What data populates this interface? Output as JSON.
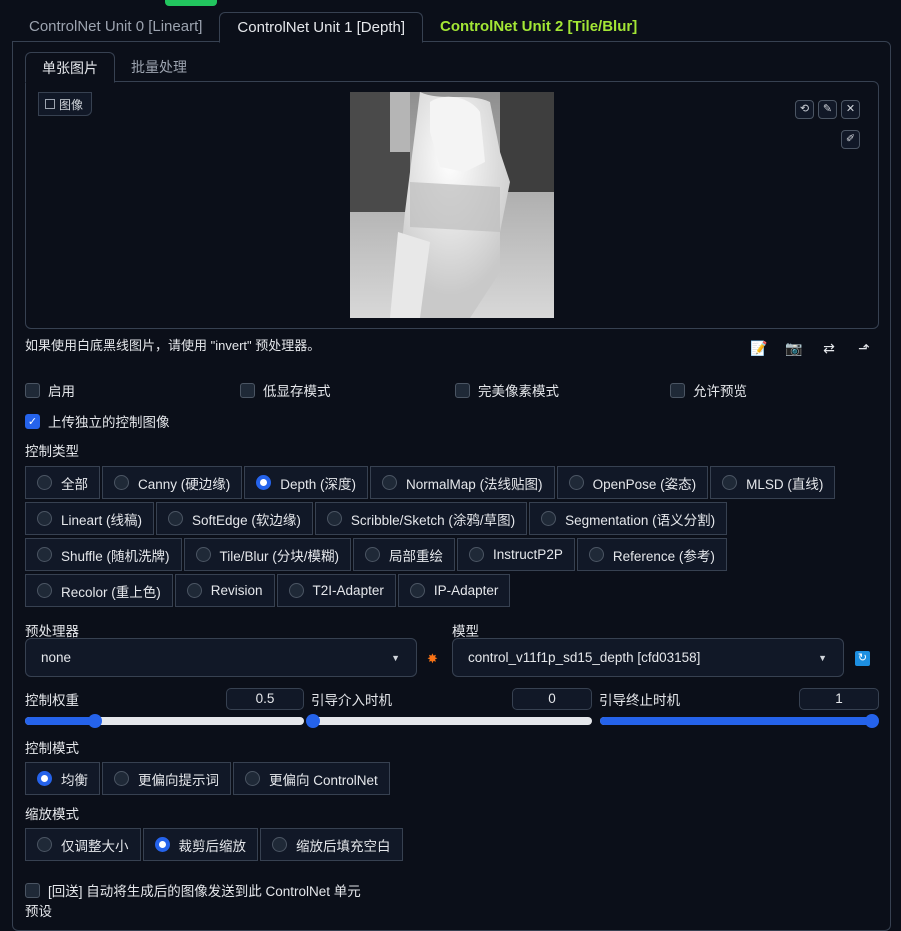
{
  "outer_tabs": [
    "ControlNet Unit 0 [Lineart]",
    "ControlNet Unit 1 [Depth]",
    "ControlNet Unit 2 [Tile/Blur]"
  ],
  "inner_tabs": [
    "单张图片",
    "批量处理"
  ],
  "image_label": "图像",
  "image_tools": {
    "reset": "⟲",
    "brush": "✎",
    "close": "✕",
    "pen": "✐"
  },
  "hint": "如果使用白底黑线图片，请使用 \"invert\" 预处理器。",
  "action_icons": [
    "📝",
    "📷",
    "⇄",
    "⬏"
  ],
  "checkboxes": [
    {
      "label": "启用",
      "checked": false
    },
    {
      "label": "低显存模式",
      "checked": false
    },
    {
      "label": "完美像素模式",
      "checked": false
    },
    {
      "label": "允许预览",
      "checked": false
    },
    {
      "label": "上传独立的控制图像",
      "checked": true
    }
  ],
  "control_type_label": "控制类型",
  "control_types": [
    [
      "全部",
      "Canny (硬边缘)",
      "Depth (深度)",
      "NormalMap (法线贴图)",
      "OpenPose (姿态)",
      "MLSD (直线)"
    ],
    [
      "Lineart (线稿)",
      "SoftEdge (软边缘)",
      "Scribble/Sketch (涂鸦/草图)",
      "Segmentation (语义分割)"
    ],
    [
      "Shuffle (随机洗牌)",
      "Tile/Blur (分块/模糊)",
      "局部重绘",
      "InstructP2P",
      "Reference (参考)"
    ],
    [
      "Recolor (重上色)",
      "Revision",
      "T2I-Adapter",
      "IP-Adapter"
    ]
  ],
  "control_type_selected": "Depth (深度)",
  "preprocessor_label": "预处理器",
  "preprocessor_value": "none",
  "model_label": "模型",
  "model_value": "control_v11f1p_sd15_depth [cfd03158]",
  "sliders": [
    {
      "label": "控制权重",
      "value": "0.5",
      "fraction": 0.25
    },
    {
      "label": "引导介入时机",
      "value": "0",
      "fraction": 0.0
    },
    {
      "label": "引导终止时机",
      "value": "1",
      "fraction": 1.0
    }
  ],
  "control_mode_label": "控制模式",
  "control_modes": [
    "均衡",
    "更偏向提示词",
    "更偏向 ControlNet"
  ],
  "control_mode_selected": "均衡",
  "resize_mode_label": "缩放模式",
  "resize_modes": [
    "仅调整大小",
    "裁剪后缩放",
    "缩放后填充空白"
  ],
  "resize_mode_selected": "裁剪后缩放",
  "loopback_label": "[回送] 自动将生成后的图像发送到此 ControlNet 单元",
  "preset_label": "预设",
  "colors": {
    "accent": "#2563eb",
    "tile_tab": "#a3e635",
    "background": "#0b0f19"
  }
}
